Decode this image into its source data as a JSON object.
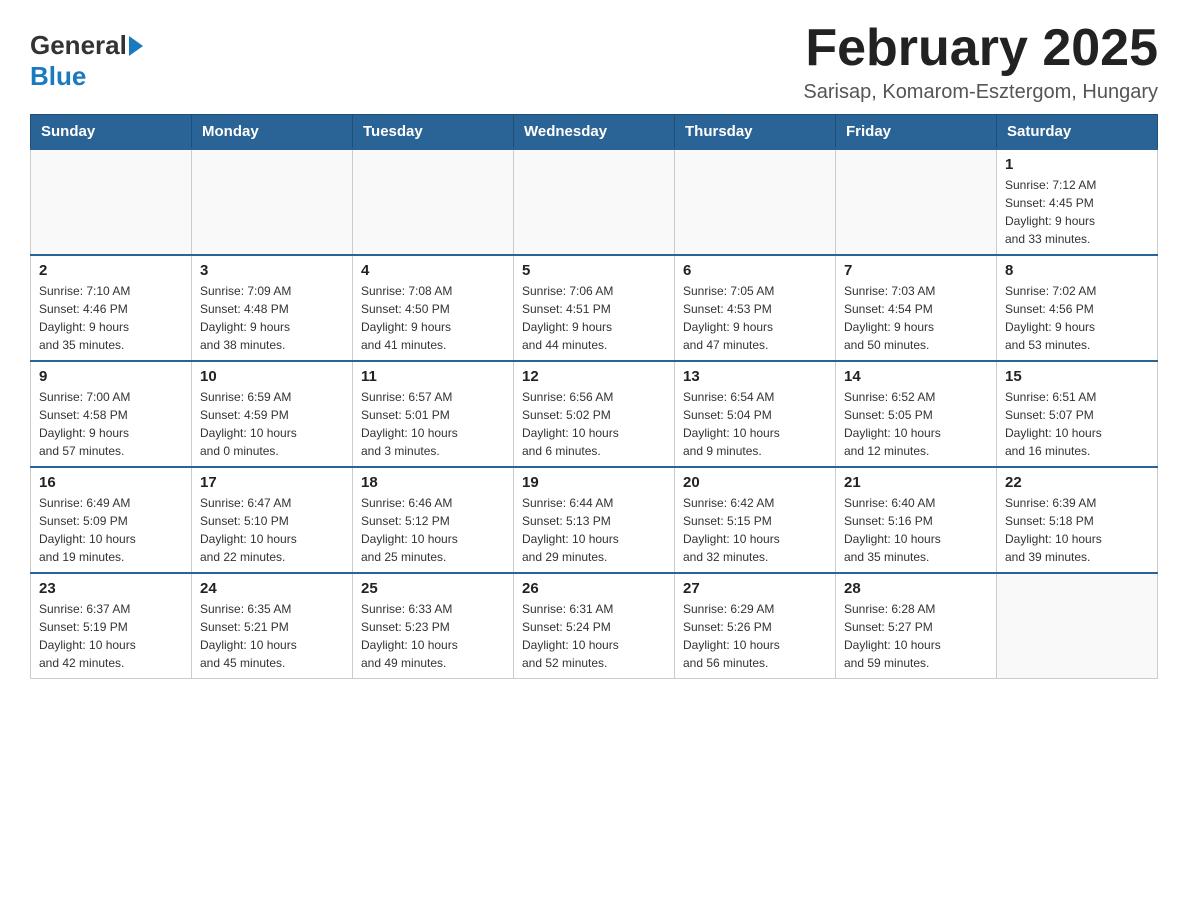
{
  "header": {
    "logo_general": "General",
    "logo_blue": "Blue",
    "month_title": "February 2025",
    "location": "Sarisap, Komarom-Esztergom, Hungary"
  },
  "days_of_week": [
    "Sunday",
    "Monday",
    "Tuesday",
    "Wednesday",
    "Thursday",
    "Friday",
    "Saturday"
  ],
  "weeks": [
    {
      "days": [
        {
          "num": "",
          "info": ""
        },
        {
          "num": "",
          "info": ""
        },
        {
          "num": "",
          "info": ""
        },
        {
          "num": "",
          "info": ""
        },
        {
          "num": "",
          "info": ""
        },
        {
          "num": "",
          "info": ""
        },
        {
          "num": "1",
          "info": "Sunrise: 7:12 AM\nSunset: 4:45 PM\nDaylight: 9 hours\nand 33 minutes."
        }
      ]
    },
    {
      "days": [
        {
          "num": "2",
          "info": "Sunrise: 7:10 AM\nSunset: 4:46 PM\nDaylight: 9 hours\nand 35 minutes."
        },
        {
          "num": "3",
          "info": "Sunrise: 7:09 AM\nSunset: 4:48 PM\nDaylight: 9 hours\nand 38 minutes."
        },
        {
          "num": "4",
          "info": "Sunrise: 7:08 AM\nSunset: 4:50 PM\nDaylight: 9 hours\nand 41 minutes."
        },
        {
          "num": "5",
          "info": "Sunrise: 7:06 AM\nSunset: 4:51 PM\nDaylight: 9 hours\nand 44 minutes."
        },
        {
          "num": "6",
          "info": "Sunrise: 7:05 AM\nSunset: 4:53 PM\nDaylight: 9 hours\nand 47 minutes."
        },
        {
          "num": "7",
          "info": "Sunrise: 7:03 AM\nSunset: 4:54 PM\nDaylight: 9 hours\nand 50 minutes."
        },
        {
          "num": "8",
          "info": "Sunrise: 7:02 AM\nSunset: 4:56 PM\nDaylight: 9 hours\nand 53 minutes."
        }
      ]
    },
    {
      "days": [
        {
          "num": "9",
          "info": "Sunrise: 7:00 AM\nSunset: 4:58 PM\nDaylight: 9 hours\nand 57 minutes."
        },
        {
          "num": "10",
          "info": "Sunrise: 6:59 AM\nSunset: 4:59 PM\nDaylight: 10 hours\nand 0 minutes."
        },
        {
          "num": "11",
          "info": "Sunrise: 6:57 AM\nSunset: 5:01 PM\nDaylight: 10 hours\nand 3 minutes."
        },
        {
          "num": "12",
          "info": "Sunrise: 6:56 AM\nSunset: 5:02 PM\nDaylight: 10 hours\nand 6 minutes."
        },
        {
          "num": "13",
          "info": "Sunrise: 6:54 AM\nSunset: 5:04 PM\nDaylight: 10 hours\nand 9 minutes."
        },
        {
          "num": "14",
          "info": "Sunrise: 6:52 AM\nSunset: 5:05 PM\nDaylight: 10 hours\nand 12 minutes."
        },
        {
          "num": "15",
          "info": "Sunrise: 6:51 AM\nSunset: 5:07 PM\nDaylight: 10 hours\nand 16 minutes."
        }
      ]
    },
    {
      "days": [
        {
          "num": "16",
          "info": "Sunrise: 6:49 AM\nSunset: 5:09 PM\nDaylight: 10 hours\nand 19 minutes."
        },
        {
          "num": "17",
          "info": "Sunrise: 6:47 AM\nSunset: 5:10 PM\nDaylight: 10 hours\nand 22 minutes."
        },
        {
          "num": "18",
          "info": "Sunrise: 6:46 AM\nSunset: 5:12 PM\nDaylight: 10 hours\nand 25 minutes."
        },
        {
          "num": "19",
          "info": "Sunrise: 6:44 AM\nSunset: 5:13 PM\nDaylight: 10 hours\nand 29 minutes."
        },
        {
          "num": "20",
          "info": "Sunrise: 6:42 AM\nSunset: 5:15 PM\nDaylight: 10 hours\nand 32 minutes."
        },
        {
          "num": "21",
          "info": "Sunrise: 6:40 AM\nSunset: 5:16 PM\nDaylight: 10 hours\nand 35 minutes."
        },
        {
          "num": "22",
          "info": "Sunrise: 6:39 AM\nSunset: 5:18 PM\nDaylight: 10 hours\nand 39 minutes."
        }
      ]
    },
    {
      "days": [
        {
          "num": "23",
          "info": "Sunrise: 6:37 AM\nSunset: 5:19 PM\nDaylight: 10 hours\nand 42 minutes."
        },
        {
          "num": "24",
          "info": "Sunrise: 6:35 AM\nSunset: 5:21 PM\nDaylight: 10 hours\nand 45 minutes."
        },
        {
          "num": "25",
          "info": "Sunrise: 6:33 AM\nSunset: 5:23 PM\nDaylight: 10 hours\nand 49 minutes."
        },
        {
          "num": "26",
          "info": "Sunrise: 6:31 AM\nSunset: 5:24 PM\nDaylight: 10 hours\nand 52 minutes."
        },
        {
          "num": "27",
          "info": "Sunrise: 6:29 AM\nSunset: 5:26 PM\nDaylight: 10 hours\nand 56 minutes."
        },
        {
          "num": "28",
          "info": "Sunrise: 6:28 AM\nSunset: 5:27 PM\nDaylight: 10 hours\nand 59 minutes."
        },
        {
          "num": "",
          "info": ""
        }
      ]
    }
  ]
}
